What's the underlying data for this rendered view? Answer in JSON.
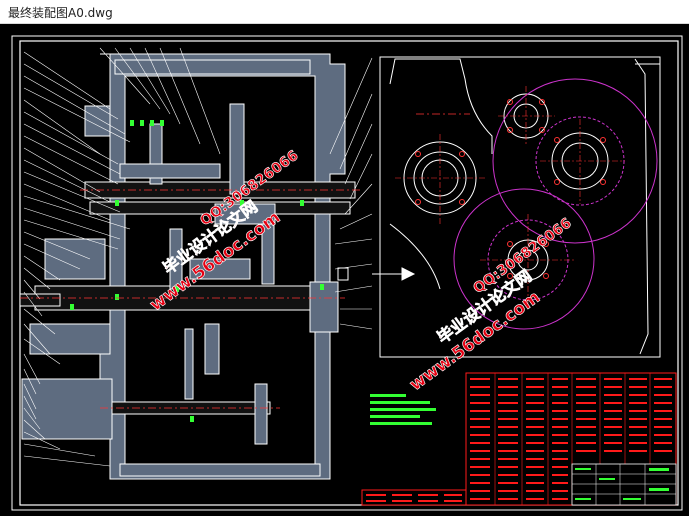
{
  "window": {
    "title": "最终装配图A0.dwg"
  },
  "watermark": {
    "site": "www.56doc.com",
    "qq": "QQ:306826066",
    "name": "毕业设计论文网"
  },
  "colors": {
    "background": "#000000",
    "frame": "#ffffff",
    "hatch": "#7a8aa0",
    "leader": "#ffffff",
    "gear": "#cc33cc",
    "note": "#33ff33",
    "table": "#ff1a1a",
    "centerline": "#ff3333",
    "watermark": "#e60012"
  },
  "icons": {
    "table_grid": "table-grid-icon",
    "gear": "gear-outline-icon"
  }
}
